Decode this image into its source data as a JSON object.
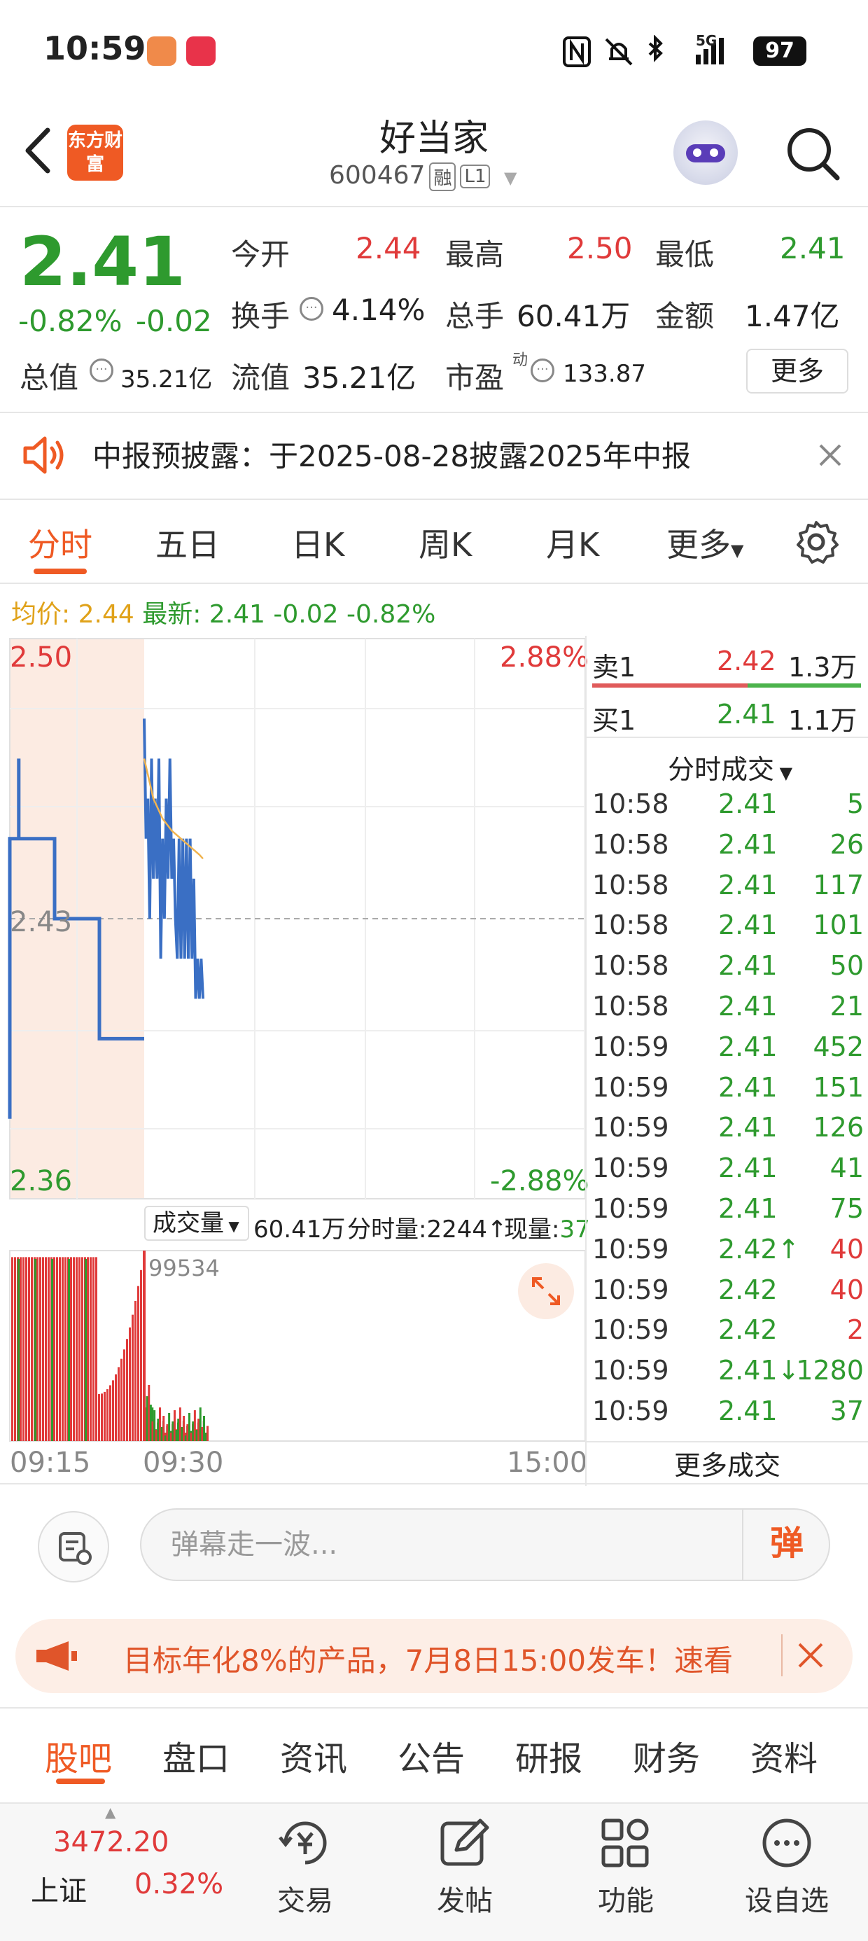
{
  "status_bar": {
    "time": "10:59",
    "battery": "97",
    "signal": "5G"
  },
  "header": {
    "logo_text": "东方财富",
    "stock_name": "好当家",
    "stock_code": "600467",
    "tag_margin": "融",
    "tag_level": "L1"
  },
  "quote": {
    "price": "2.41",
    "change_pct": "-0.82%",
    "change": "-0.02",
    "open_label": "今开",
    "open": "2.44",
    "high_label": "最高",
    "high": "2.50",
    "low_label": "最低",
    "low": "2.41",
    "turnover_label": "换手",
    "turnover": "4.14%",
    "volume_label": "总手",
    "volume": "60.41万",
    "amount_label": "金额",
    "amount": "1.47亿",
    "mktcap_label": "总值",
    "mktcap": "35.21亿",
    "float_label": "流值",
    "float_cap": "35.21亿",
    "pe_label": "市盈",
    "pe_sup": "动",
    "pe": "133.87",
    "more": "更多"
  },
  "notice": {
    "text": "中报预披露：于2025-08-28披露2025年中报"
  },
  "chart_tabs": [
    "分时",
    "五日",
    "日K",
    "周K",
    "月K",
    "更多"
  ],
  "avg_bar": {
    "avg_label": "均价:",
    "avg": "2.44",
    "latest_label": "最新:",
    "latest": "2.41",
    "chg": "-0.02",
    "chg_pct": "-0.82%"
  },
  "chart_data": {
    "type": "line",
    "title": "",
    "y_top": "2.50",
    "y_mid": "2.43",
    "y_bottom": "2.36",
    "pct_top": "2.88%",
    "pct_bottom": "-2.88%",
    "ylim": [
      2.36,
      2.5
    ],
    "x_ticks": [
      "09:15",
      "09:30",
      "15:00"
    ],
    "pre_open_price": [
      [
        "09:15",
        2.38
      ],
      [
        "09:15",
        2.45
      ],
      [
        "09:16",
        2.45
      ],
      [
        "09:16",
        2.47
      ],
      [
        "09:16",
        2.45
      ],
      [
        "09:20",
        2.45
      ],
      [
        "09:20",
        2.43
      ],
      [
        "09:25",
        2.43
      ],
      [
        "09:25",
        2.4
      ],
      [
        "09:30",
        2.4
      ]
    ],
    "price": [
      [
        "09:30",
        2.48
      ],
      [
        "09:31",
        2.45
      ],
      [
        "09:32",
        2.46
      ],
      [
        "09:33",
        2.43
      ],
      [
        "09:34",
        2.47
      ],
      [
        "09:35",
        2.44
      ],
      [
        "09:36",
        2.46
      ],
      [
        "09:37",
        2.44
      ],
      [
        "09:38",
        2.47
      ],
      [
        "09:39",
        2.42
      ],
      [
        "09:40",
        2.45
      ],
      [
        "09:41",
        2.43
      ],
      [
        "09:42",
        2.46
      ],
      [
        "09:43",
        2.44
      ],
      [
        "09:44",
        2.47
      ],
      [
        "09:45",
        2.44
      ],
      [
        "09:46",
        2.45
      ],
      [
        "09:47",
        2.43
      ],
      [
        "09:48",
        2.42
      ],
      [
        "09:49",
        2.45
      ],
      [
        "09:50",
        2.42
      ],
      [
        "09:51",
        2.45
      ],
      [
        "09:52",
        2.42
      ],
      [
        "09:53",
        2.45
      ],
      [
        "09:54",
        2.42
      ],
      [
        "09:55",
        2.45
      ],
      [
        "09:56",
        2.42
      ],
      [
        "09:57",
        2.44
      ],
      [
        "09:58",
        2.41
      ],
      [
        "09:59",
        2.42
      ],
      [
        "10:00",
        2.41
      ],
      [
        "10:01",
        2.42
      ],
      [
        "10:02",
        2.41
      ]
    ],
    "avg_price": [
      [
        "09:30",
        2.47
      ],
      [
        "09:35",
        2.46
      ],
      [
        "09:40",
        2.455
      ],
      [
        "09:45",
        2.452
      ],
      [
        "09:50",
        2.45
      ],
      [
        "09:55",
        2.448
      ],
      [
        "10:00",
        2.446
      ],
      [
        "10:02",
        2.445
      ]
    ],
    "volume_label": "成交量",
    "total_volume": "60.41万",
    "minute_volume": "分时量:2244↑",
    "current_volume": "现量:",
    "current_volume_value": "37",
    "max_volume": "99534"
  },
  "order_book": {
    "sell1_label": "卖1",
    "sell1_price": "2.42",
    "sell1_vol": "1.3万",
    "buy1_label": "买1",
    "buy1_price": "2.41",
    "buy1_vol": "1.1万",
    "ticks_title": "分时成交",
    "ticks": [
      {
        "t": "10:58",
        "p": "2.41",
        "v": "5",
        "pc": "green",
        "vc": "green",
        "arrow": ""
      },
      {
        "t": "10:58",
        "p": "2.41",
        "v": "26",
        "pc": "green",
        "vc": "green",
        "arrow": ""
      },
      {
        "t": "10:58",
        "p": "2.41",
        "v": "117",
        "pc": "green",
        "vc": "green",
        "arrow": ""
      },
      {
        "t": "10:58",
        "p": "2.41",
        "v": "101",
        "pc": "green",
        "vc": "green",
        "arrow": ""
      },
      {
        "t": "10:58",
        "p": "2.41",
        "v": "50",
        "pc": "green",
        "vc": "green",
        "arrow": ""
      },
      {
        "t": "10:58",
        "p": "2.41",
        "v": "21",
        "pc": "green",
        "vc": "green",
        "arrow": ""
      },
      {
        "t": "10:59",
        "p": "2.41",
        "v": "452",
        "pc": "green",
        "vc": "green",
        "arrow": ""
      },
      {
        "t": "10:59",
        "p": "2.41",
        "v": "151",
        "pc": "green",
        "vc": "green",
        "arrow": ""
      },
      {
        "t": "10:59",
        "p": "2.41",
        "v": "126",
        "pc": "green",
        "vc": "green",
        "arrow": ""
      },
      {
        "t": "10:59",
        "p": "2.41",
        "v": "41",
        "pc": "green",
        "vc": "green",
        "arrow": ""
      },
      {
        "t": "10:59",
        "p": "2.41",
        "v": "75",
        "pc": "green",
        "vc": "green",
        "arrow": ""
      },
      {
        "t": "10:59",
        "p": "2.42",
        "v": "40",
        "pc": "green",
        "vc": "red",
        "arrow": "↑"
      },
      {
        "t": "10:59",
        "p": "2.42",
        "v": "40",
        "pc": "green",
        "vc": "red",
        "arrow": ""
      },
      {
        "t": "10:59",
        "p": "2.42",
        "v": "2",
        "pc": "green",
        "vc": "red",
        "arrow": ""
      },
      {
        "t": "10:59",
        "p": "2.41",
        "v": "1280",
        "pc": "green",
        "vc": "green",
        "arrow": "↓"
      },
      {
        "t": "10:59",
        "p": "2.41",
        "v": "37",
        "pc": "green",
        "vc": "green",
        "arrow": ""
      }
    ],
    "more_ticks": "更多成交"
  },
  "danmu": {
    "placeholder": "弹幕走一波...",
    "button": "弹"
  },
  "promo": {
    "text": "目标年化8%的产品，7月8日15:00发车！速看"
  },
  "bottom_tabs": [
    "股吧",
    "盘口",
    "资讯",
    "公告",
    "研报",
    "财务",
    "资料"
  ],
  "bottom_nav": {
    "index_value": "3472.20",
    "index_name": "上证",
    "index_pct": "0.32%",
    "items": [
      "交易",
      "发帖",
      "功能",
      "设自选"
    ]
  },
  "colors": {
    "up": "#e03a3a",
    "down": "#2e9a2e",
    "brand": "#ef5a24",
    "price_line": "#3a6fc4",
    "avg_line": "#f0b450"
  }
}
